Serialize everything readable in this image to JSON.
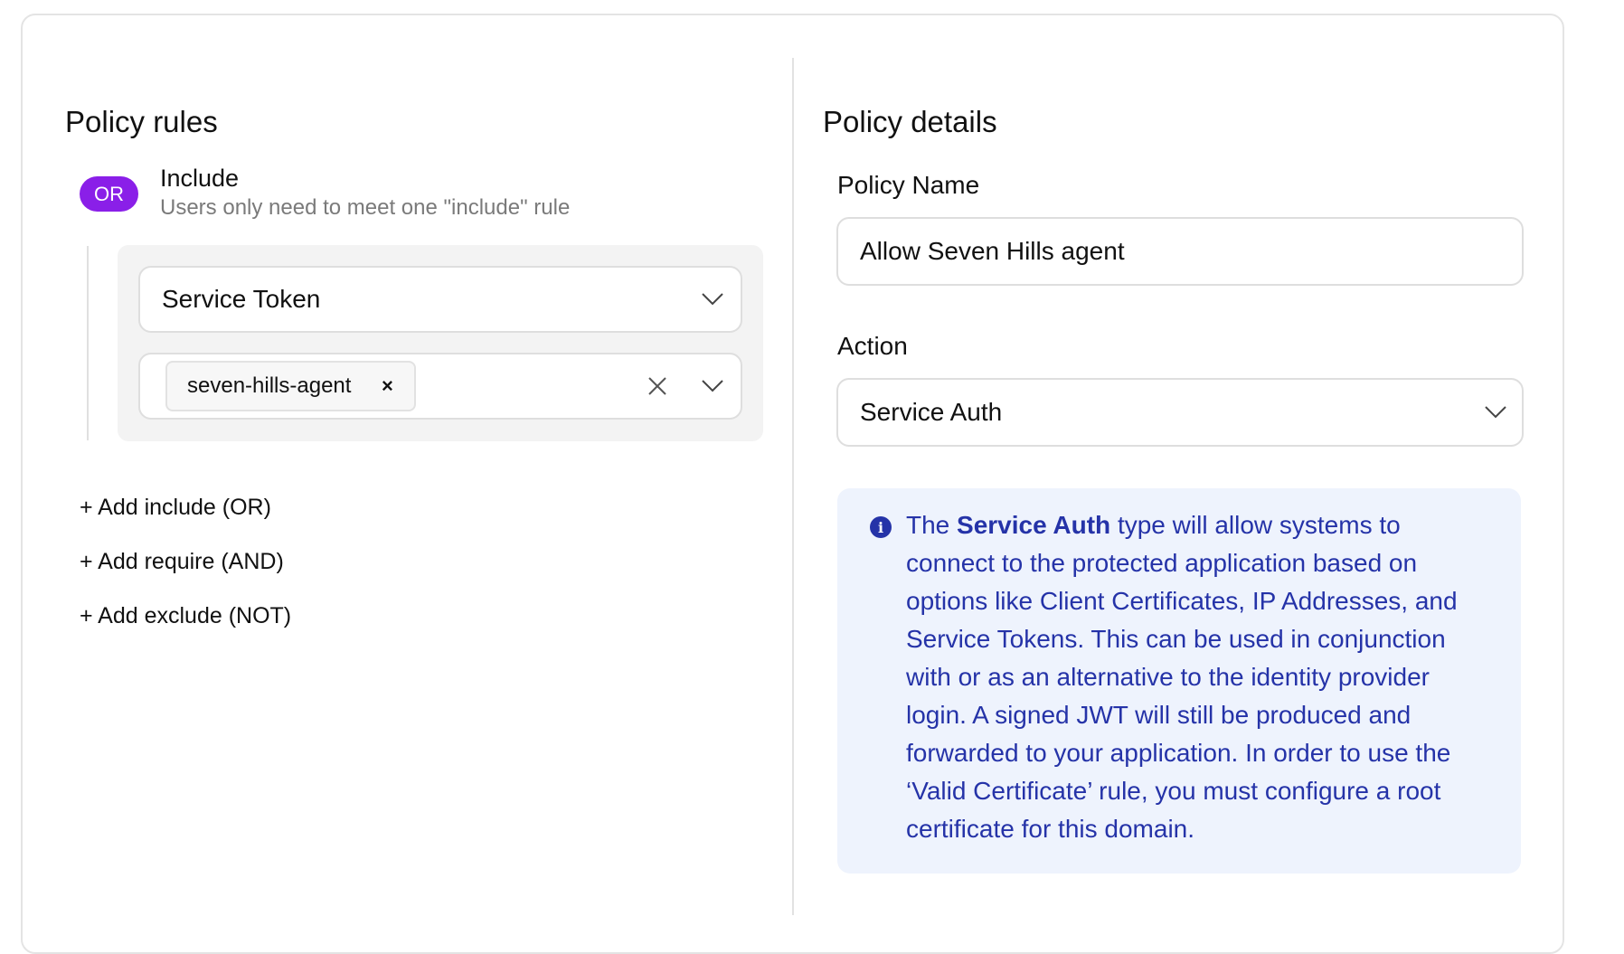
{
  "left_panel": {
    "title": "Policy rules",
    "include": {
      "badge": "OR",
      "label": "Include",
      "description": "Users only need to meet one \"include\" rule"
    },
    "rule": {
      "selector_value": "Service Token",
      "selected_chips": [
        "seven-hills-agent"
      ],
      "chip_remove_glyph": "×"
    },
    "add_links": [
      "+ Add include (OR)",
      "+ Add require (AND)",
      "+ Add exclude (NOT)"
    ]
  },
  "right_panel": {
    "title": "Policy details",
    "policy_name_label": "Policy Name",
    "policy_name_value": "Allow Seven Hills agent",
    "action_label": "Action",
    "action_value": "Service Auth",
    "info": {
      "icon": "info-icon",
      "text_before": "The ",
      "text_bold": "Service Auth",
      "text_after": " type will allow systems to connect to the protected application based on options like Client Certificates, IP Addresses, and Service Tokens. This can be used in conjunction with or as an alternative to the identity provider login. A signed JWT will still be produced and forwarded to your application. In order to use the ‘Valid Certificate’ rule, you must configure a root certificate for this domain."
    }
  },
  "colors": {
    "or_badge": "#8a1fe8",
    "info_background": "#eef3fd",
    "info_text": "#2533a8"
  }
}
